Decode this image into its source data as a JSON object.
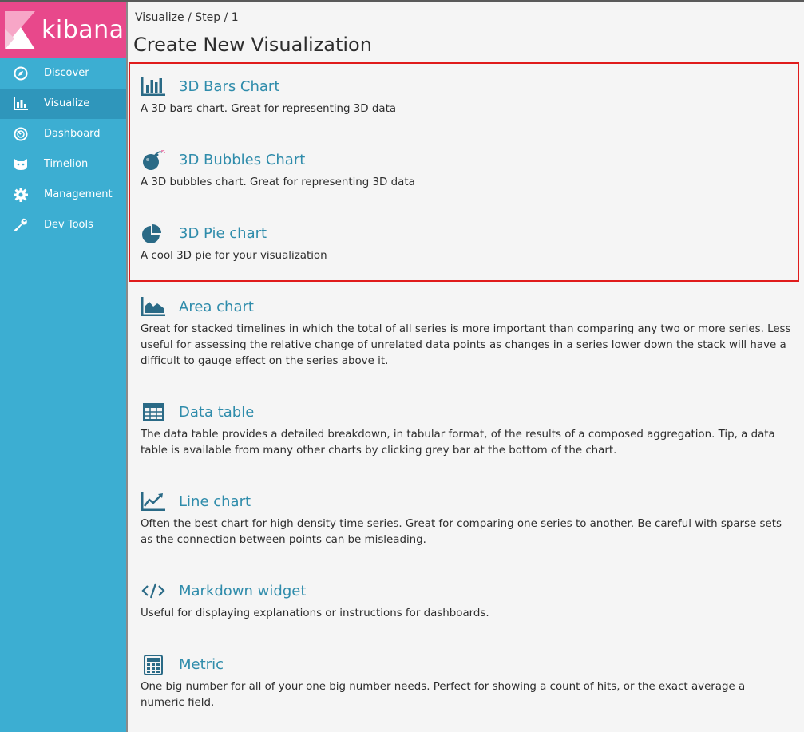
{
  "sidebar": {
    "logo_text": "kibana",
    "items": [
      {
        "label": "Discover",
        "icon": "compass-icon",
        "active": false
      },
      {
        "label": "Visualize",
        "icon": "bar-chart-icon",
        "active": true
      },
      {
        "label": "Dashboard",
        "icon": "dashboard-gauge-icon",
        "active": false
      },
      {
        "label": "Timelion",
        "icon": "timelion-cat-icon",
        "active": false
      },
      {
        "label": "Management",
        "icon": "gear-icon",
        "active": false
      },
      {
        "label": "Dev Tools",
        "icon": "wrench-icon",
        "active": false
      }
    ]
  },
  "header": {
    "breadcrumb": "Visualize / Step / 1",
    "title": "Create New Visualization"
  },
  "visualizations": [
    {
      "title": "3D Bars Chart",
      "icon": "bar-chart-icon",
      "description": "A 3D bars chart. Great for representing 3D data"
    },
    {
      "title": "3D Bubbles Chart",
      "icon": "bomb-icon",
      "description": "A 3D bubbles chart. Great for representing 3D data"
    },
    {
      "title": "3D Pie chart",
      "icon": "pie-chart-icon",
      "description": "A cool 3D pie for your visualization"
    },
    {
      "title": "Area chart",
      "icon": "area-chart-icon",
      "description": "Great for stacked timelines in which the total of all series is more important than comparing any two or more series. Less useful for assessing the relative change of unrelated data points as changes in a series lower down the stack will have a difficult to gauge effect on the series above it."
    },
    {
      "title": "Data table",
      "icon": "table-icon",
      "description": "The data table provides a detailed breakdown, in tabular format, of the results of a composed aggregation. Tip, a data table is available from many other charts by clicking grey bar at the bottom of the chart."
    },
    {
      "title": "Line chart",
      "icon": "line-chart-icon",
      "description": "Often the best chart for high density time series. Great for comparing one series to another. Be careful with sparse sets as the connection between points can be misleading."
    },
    {
      "title": "Markdown widget",
      "icon": "code-icon",
      "description": "Useful for displaying explanations or instructions for dashboards."
    },
    {
      "title": "Metric",
      "icon": "calculator-icon",
      "description": "One big number for all of your one big number needs. Perfect for showing a count of hits, or the exact average a numeric field."
    }
  ],
  "colors": {
    "sidebar": "#3caed2",
    "sidebar_active": "#2f96bb",
    "logo_bg": "#e8488b",
    "link": "#2f8cab",
    "highlight_border": "#e01c1c"
  }
}
